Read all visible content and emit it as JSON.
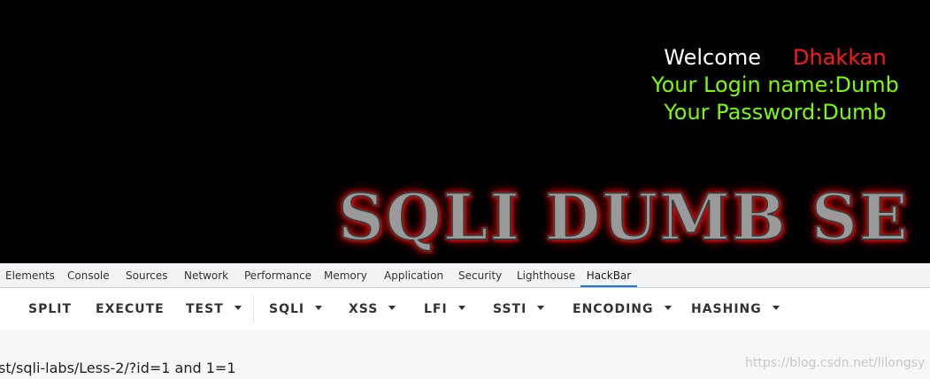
{
  "page": {
    "welcome_word": "Welcome",
    "user_name": "Dhakkan",
    "login_line": "Your Login name:Dumb",
    "password_line": "Your Password:Dumb",
    "banner_text": "SQLI DUMB SE"
  },
  "devtools": {
    "tabs": [
      {
        "label": "Elements"
      },
      {
        "label": "Console"
      },
      {
        "label": "Sources"
      },
      {
        "label": "Network"
      },
      {
        "label": "Performance"
      },
      {
        "label": "Memory"
      },
      {
        "label": "Application"
      },
      {
        "label": "Security"
      },
      {
        "label": "Lighthouse"
      },
      {
        "label": "HackBar",
        "active": true
      }
    ]
  },
  "hackbar": {
    "buttons": [
      {
        "label": "SPLIT",
        "dropdown": false
      },
      {
        "label": "EXECUTE",
        "dropdown": false
      },
      {
        "label": "TEST",
        "dropdown": true
      },
      {
        "label": "SQLI",
        "dropdown": true
      },
      {
        "label": "XSS",
        "dropdown": true
      },
      {
        "label": "LFI",
        "dropdown": true
      },
      {
        "label": "SSTI",
        "dropdown": true
      },
      {
        "label": "ENCODING",
        "dropdown": true
      },
      {
        "label": "HASHING",
        "dropdown": true
      }
    ],
    "url_value": "st/sqli-labs/Less-2/?id=1 and 1=1"
  },
  "watermark": "https://blog.csdn.net/lilongsy",
  "colors": {
    "page_bg": "#000000",
    "welcome": "#ffffff",
    "user_name": "#ff1a1a",
    "credentials": "#7cfc00",
    "banner_glow": "#ff0000",
    "active_tab_underline": "#1a73e8"
  }
}
